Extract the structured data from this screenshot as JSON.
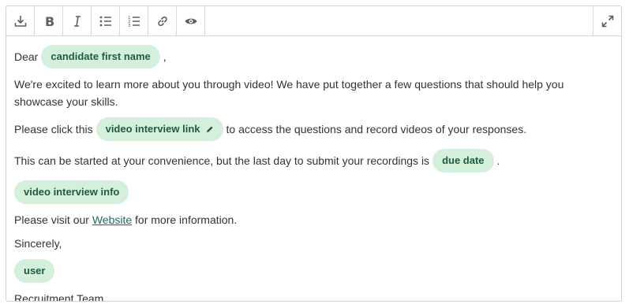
{
  "toolbar": {
    "buttons": [
      {
        "name": "upload-icon"
      },
      {
        "name": "bold-icon"
      },
      {
        "name": "italic-icon"
      },
      {
        "name": "bulleted-list-icon"
      },
      {
        "name": "numbered-list-icon"
      },
      {
        "name": "link-icon"
      },
      {
        "name": "preview-eye-icon"
      }
    ],
    "expand": {
      "name": "expand-icon"
    }
  },
  "body": {
    "greeting": {
      "prefix": "Dear",
      "token": "candidate first name",
      "suffix": ","
    },
    "intro": "We're excited to learn more about you through video! We have put together a few questions that should help you showcase your skills.",
    "click": {
      "prefix": "Please click this",
      "token": "video interview link",
      "suffix": "to access the questions and record videos of your responses."
    },
    "deadline": {
      "prefix": "This can be started at your convenience, but the last day to submit your recordings is",
      "token": "due date",
      "suffix": "."
    },
    "info_token": "video interview info",
    "visit": {
      "prefix": "Please visit our",
      "link": "Website",
      "suffix": "for more information."
    },
    "closing": "Sincerely,",
    "user_token": "user",
    "team": "Recruitment Team"
  },
  "colors": {
    "chip_bg": "#d5efdd",
    "chip_text": "#1c5c44",
    "link": "#1b6e63",
    "border": "#cfd3d8"
  }
}
